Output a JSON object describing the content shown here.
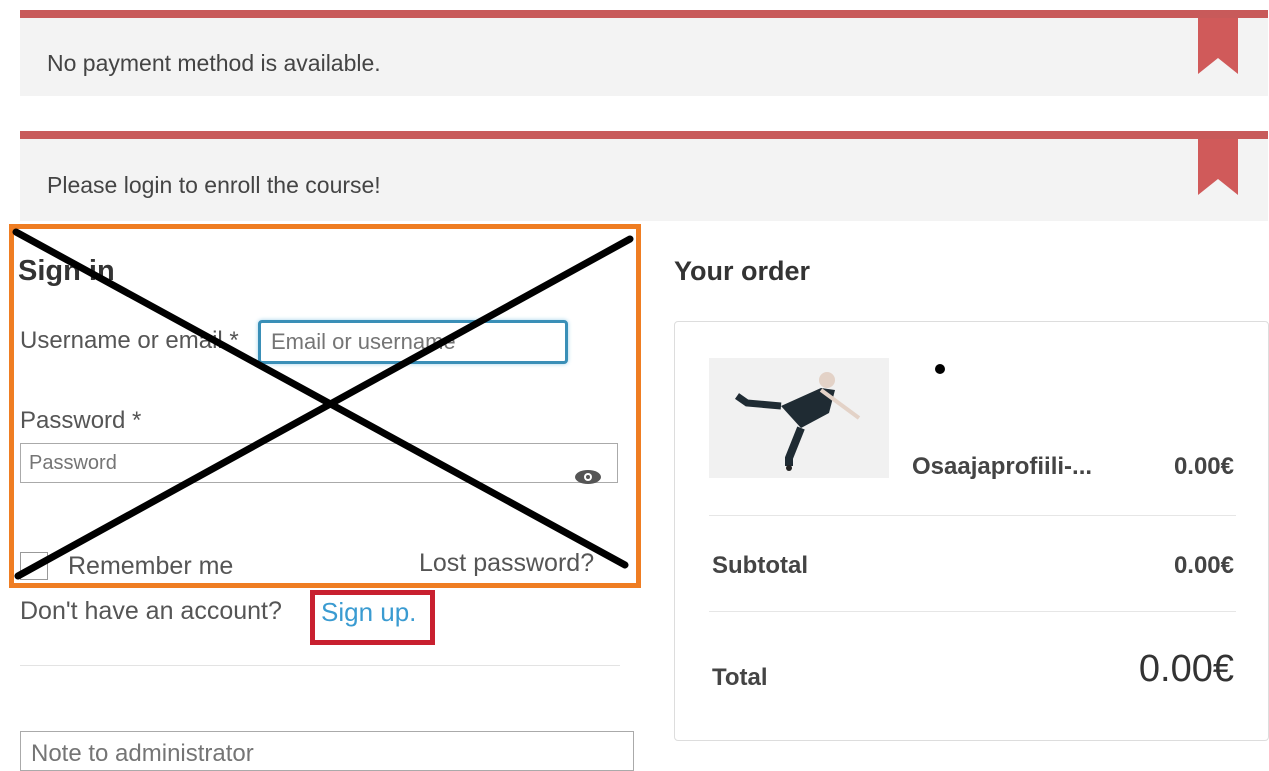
{
  "notices": [
    {
      "message": "No payment method is available."
    },
    {
      "message": "Please login to enroll the course!"
    }
  ],
  "signin": {
    "title": "Sign in",
    "username_label": "Username or email *",
    "username_placeholder": "Email or username",
    "password_label": "Password *",
    "password_placeholder": "Password",
    "remember_label": "Remember me",
    "lost_password": "Lost password?",
    "no_account_text": "Don't have an account?",
    "signup_link": "Sign up."
  },
  "note": {
    "placeholder": "Note to administrator"
  },
  "order": {
    "title": "Your order",
    "product": {
      "name": "Osaajaprofiili-...",
      "price": "0.00€"
    },
    "subtotal": {
      "label": "Subtotal",
      "value": "0.00€"
    },
    "total": {
      "label": "Total",
      "value": "0.00€"
    }
  },
  "colors": {
    "notice_bar": "#c85a5a",
    "annotation_orange": "#ef7d22",
    "annotation_red": "#c8202f",
    "link": "#3a9bd1",
    "input_focus": "#3a8fb7"
  }
}
